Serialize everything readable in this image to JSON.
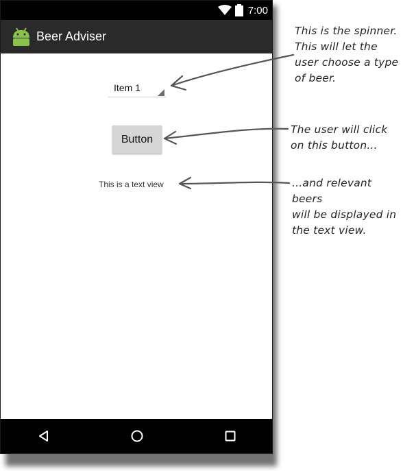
{
  "status_bar": {
    "time": "7:00",
    "icons": [
      "wifi-icon",
      "battery-icon"
    ]
  },
  "action_bar": {
    "title": "Beer Adviser",
    "icon": "android-icon"
  },
  "content": {
    "spinner": {
      "selected": "Item 1"
    },
    "button_label": "Button",
    "text_view": "This is a text view"
  },
  "nav_bar": {
    "icons": [
      "back-icon",
      "home-icon",
      "recents-icon"
    ]
  },
  "annotations": {
    "spinner_note": [
      "This is the spinner.",
      "This will let the",
      "user choose a type",
      "of beer."
    ],
    "button_note": [
      "The user will click",
      "on this button..."
    ],
    "textview_note": [
      "...and relevant beers",
      "will be displayed in",
      "the text view."
    ]
  },
  "colors": {
    "action_bar": "#2a2a2a",
    "status_bar": "#000000",
    "nav_bar": "#000000",
    "button": "#d6d6d6",
    "android_green": "#8bc34a"
  }
}
